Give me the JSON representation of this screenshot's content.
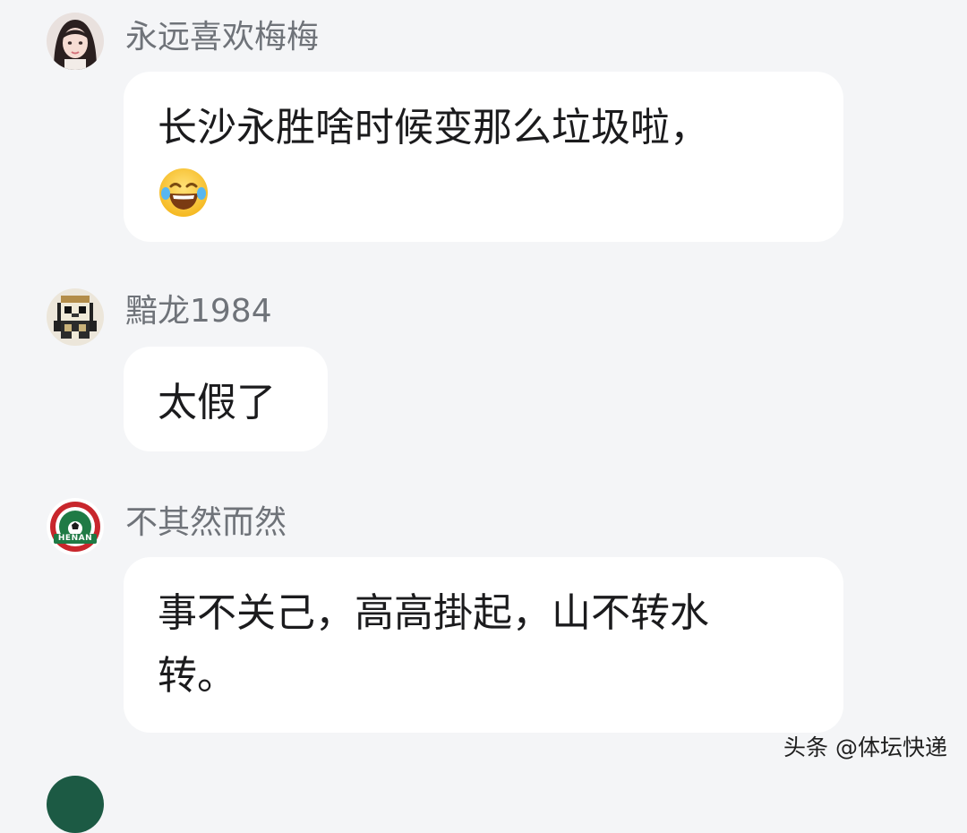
{
  "colors": {
    "page_background": "#f4f5f7",
    "bubble_background": "#ffffff",
    "username_color": "#6f7379",
    "text_color": "#1b1b1d",
    "henan_green": "#1f7a45",
    "henan_red": "#c8262c"
  },
  "comments": [
    {
      "username": "永远喜欢梅梅",
      "avatar_icon": "girl-portrait-avatar",
      "text": "长沙永胜啥时候变那么垃圾啦，",
      "emoji_icon": "laughing-tears-emoji"
    },
    {
      "username": "黯龙1984",
      "avatar_icon": "pixel-character-avatar",
      "text": "太假了"
    },
    {
      "username": "不其然而然",
      "avatar_icon": "henan-club-logo-avatar",
      "avatar_logo_text": "HENAN",
      "text": "事不关己，高高掛起，山不转水\n转。"
    }
  ],
  "watermark": "头条 @体坛快递"
}
